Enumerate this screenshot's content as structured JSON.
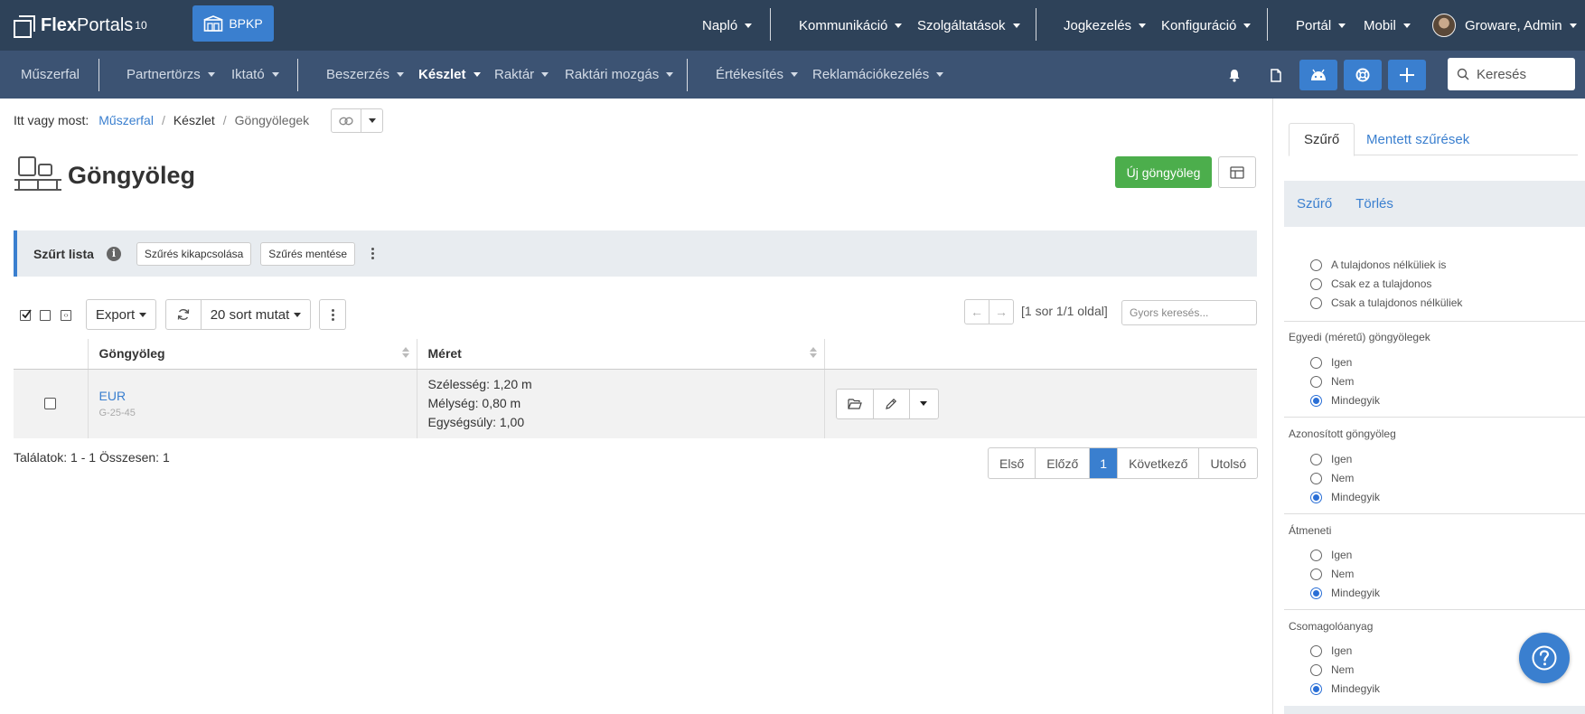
{
  "brand": {
    "name_bold": "Flex",
    "name_rest": "Portals",
    "version": "10",
    "org_button": "BPKP"
  },
  "topnav": {
    "items": [
      "Napló",
      "Kommunikáció",
      "Szolgáltatások",
      "Jogkezelés",
      "Konfiguráció",
      "Portál",
      "Mobil"
    ],
    "user": "Groware, Admin"
  },
  "secnav": {
    "items": [
      "Műszerfal",
      "Partnertörzs",
      "Iktató",
      "Beszerzés",
      "Készlet",
      "Raktár",
      "Raktári mozgás",
      "Értékesítés",
      "Reklamációkezelés"
    ],
    "active": "Készlet",
    "search_placeholder": "Keresés"
  },
  "breadcrumb": {
    "prefix": "Itt vagy most:",
    "items": [
      "Műszerfal",
      "Készlet",
      "Göngyölegek"
    ]
  },
  "page": {
    "title": "Göngyöleg",
    "new_button": "Új göngyöleg"
  },
  "filterbar": {
    "label": "Szűrt lista",
    "info": "i",
    "disable_button": "Szűrés kikapcsolása",
    "save_button": "Szűrés mentése"
  },
  "toolbar": {
    "export": "Export",
    "rows": "20 sort mutat",
    "page_info": "[1 sor 1/1 oldal]",
    "quick_search_placeholder": "Gyors keresés..."
  },
  "table": {
    "columns": [
      "Göngyöleg",
      "Méret"
    ],
    "rows": [
      {
        "name": "EUR",
        "code": "G-25-45",
        "width": "Szélesség: 1,20 m",
        "depth": "Mélység: 0,80 m",
        "unit_weight": "Egységsúly: 1,00"
      }
    ]
  },
  "results": "Találatok: 1 - 1 Összesen: 1",
  "pagination": {
    "first": "Első",
    "prev": "Előző",
    "current": "1",
    "next": "Következő",
    "last": "Utolsó"
  },
  "rightpanel": {
    "tabs": [
      "Szűrő",
      "Mentett szűrések"
    ],
    "actions": [
      "Szűrő",
      "Törlés"
    ],
    "owner_options": [
      "A tulajdonos nélküliek is",
      "Csak ez a tulajdonos",
      "Csak a tulajdonos nélküliek"
    ],
    "groups": [
      {
        "label": "Egyedi (méretű) göngyölegek",
        "options": [
          "Igen",
          "Nem",
          "Mindegyik"
        ],
        "selected": 2
      },
      {
        "label": "Azonosított göngyöleg",
        "options": [
          "Igen",
          "Nem",
          "Mindegyik"
        ],
        "selected": 2
      },
      {
        "label": "Átmeneti",
        "options": [
          "Igen",
          "Nem",
          "Mindegyik"
        ],
        "selected": 2
      },
      {
        "label": "Csomagolóanyag",
        "options": [
          "Igen",
          "Nem",
          "Mindegyik"
        ],
        "selected": 2
      }
    ]
  },
  "colors": {
    "topbar": "#2e4259",
    "secbar": "#3c5373",
    "accent": "#3a7fcf",
    "success": "#4cae4c"
  }
}
